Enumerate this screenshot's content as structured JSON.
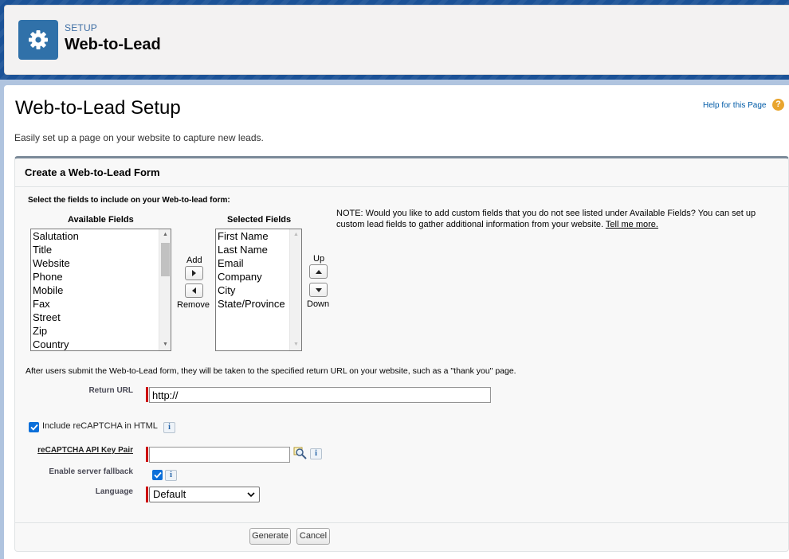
{
  "header": {
    "breadcrumb": "SETUP",
    "title": "Web-to-Lead",
    "icon": "gear-icon"
  },
  "page": {
    "title": "Web-to-Lead Setup",
    "help_link": "Help for this Page",
    "description": "Easily set up a page on your website to capture new leads."
  },
  "form": {
    "section_title": "Create a Web-to-Lead Form",
    "instructions": "Select the fields to include on your Web-to-lead form:",
    "available_label": "Available Fields",
    "selected_label": "Selected Fields",
    "available_fields": [
      "Salutation",
      "Title",
      "Website",
      "Phone",
      "Mobile",
      "Fax",
      "Street",
      "Zip",
      "Country"
    ],
    "selected_fields": [
      "First Name",
      "Last Name",
      "Email",
      "Company",
      "City",
      "State/Province"
    ],
    "add_label": "Add",
    "remove_label": "Remove",
    "up_label": "Up",
    "down_label": "Down",
    "note_text": "NOTE: Would you like to add custom fields that you do not see listed under Available Fields? You can set up custom lead fields to gather additional information from your website.",
    "note_link": "Tell me more.",
    "return_info": "After users submit the Web-to-Lead form, they will be taken to the specified return URL on your website, such as a \"thank you\" page.",
    "return_url_label": "Return URL",
    "return_url_value": "http://",
    "recaptcha_label": "Include reCAPTCHA in HTML",
    "recaptcha_checked": true,
    "api_key_label": "reCAPTCHA API Key Pair",
    "api_key_value": "",
    "server_fallback_label": "Enable server fallback",
    "server_fallback_checked": true,
    "language_label": "Language",
    "language_value": "Default",
    "info_glyph": "i"
  },
  "footer": {
    "generate_label": "Generate",
    "cancel_label": "Cancel"
  },
  "colors": {
    "brand_blue": "#1b5297",
    "tile_blue": "#3071a9",
    "required_red": "#cc0000",
    "link_blue": "#015ba7"
  }
}
